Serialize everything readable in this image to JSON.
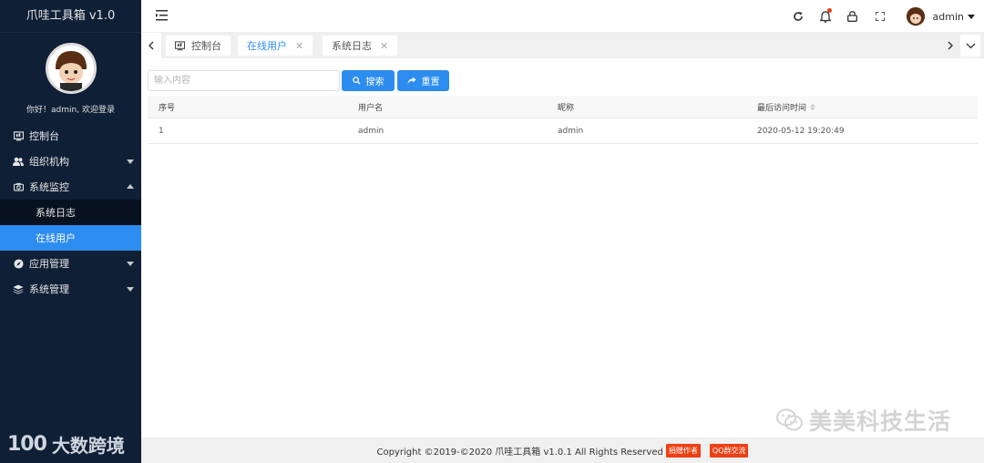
{
  "app": {
    "title": "爪哇工具箱 v1.0"
  },
  "sidebar": {
    "welcome": "你好！admin, 欢迎登录",
    "menu": [
      {
        "label": "控制台",
        "icon": "monitor-icon"
      },
      {
        "label": "组织机构",
        "icon": "users-icon"
      },
      {
        "label": "系统监控",
        "icon": "camera-icon",
        "children": [
          {
            "label": "系统日志"
          },
          {
            "label": "在线用户",
            "active": true
          }
        ]
      },
      {
        "label": "应用管理",
        "icon": "compass-icon"
      },
      {
        "label": "系统管理",
        "icon": "layers-icon"
      }
    ],
    "watermark_logo": "100",
    "watermark_text": "大数跨境"
  },
  "header": {
    "user_name": "admin",
    "icons": [
      "refresh-icon",
      "bell-icon",
      "lock-icon",
      "fullscreen-icon"
    ]
  },
  "tabs": [
    {
      "label": "控制台",
      "icon": "monitor-icon",
      "closable": false
    },
    {
      "label": "在线用户",
      "closable": true,
      "active": true
    },
    {
      "label": "系统日志",
      "closable": true
    }
  ],
  "search": {
    "placeholder": "输入内容",
    "value": "",
    "search_label": "搜索",
    "reset_label": "重置"
  },
  "table": {
    "columns": [
      "序号",
      "用户名",
      "昵称",
      "最后访问时间"
    ],
    "rows": [
      [
        "1",
        "admin",
        "admin",
        "2020-05-12 19:20:49"
      ]
    ]
  },
  "footer": {
    "copyright": "Copyright ©2019-©2020 爪哇工具箱 v1.0.1 All Rights Reserved",
    "badge_donate": "捐赠作者",
    "badge_qq": "QQ群交流"
  },
  "watermark_right": "美美科技生活",
  "colors": {
    "sidebar": "#0f1f35",
    "accent": "#2d8cf0",
    "danger": "#ed4014"
  }
}
